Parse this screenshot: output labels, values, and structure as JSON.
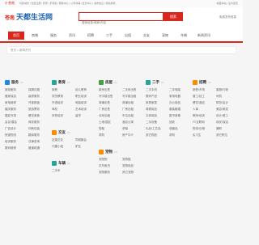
{
  "topbar": {
    "city": "苍南",
    "links": "切换城市 | 免费注册 | 登录 | 手机版 | 帮助中心 | 公司商铺 | 会员中心 | 发布信息 | 网站导航",
    "right": "收藏本站 | 设为首页"
  },
  "header": {
    "city_tag": "苍南",
    "site_name": "天都生活网",
    "search_placeholder": "搜索信息/商家/内容",
    "search_button": "搜索",
    "right_text": "免费发布信息"
  },
  "nav": {
    "items": [
      "首页",
      "商铺",
      "服务",
      "资讯",
      "招聘",
      "二手",
      "出租",
      "交友",
      "宠物",
      "车辆",
      "新闻资讯"
    ]
  },
  "breadcrumb": "首页 > 新闻资讯",
  "categories": [
    {
      "name": "服务",
      "color": "#1e88e5",
      "count": "(0)",
      "items": [
        "家政服务",
        "保姆月嫂",
        "搬家保洁",
        "装修服务",
        "家电维修",
        "开锁换锁",
        "婚庆服务",
        "旅游票务",
        "摄影写真",
        "餐饮美食",
        "会议/展会",
        "商务服务",
        "广告设计",
        "印刷包装",
        "快递物流",
        "翻译服务",
        "培训服务",
        "法律咨询",
        "数码维修",
        "管道疏通"
      ]
    },
    {
      "name": "教育",
      "color": "#26a69a",
      "count": "(0)",
      "items": [
        "家教",
        "幼儿教育",
        "学历教育",
        "职业培训",
        "外语培训",
        "电脑培训",
        "驾校",
        "艺术培训",
        "体育培训",
        "留学"
      ]
    },
    {
      "name": "交友",
      "color": "#fb8c00",
      "count": "(0)",
      "items": [
        "征婚交友",
        "同城聚会",
        "兴趣小组",
        "驴友"
      ]
    },
    {
      "name": "车辆",
      "color": "#26a69a",
      "count": "(0)",
      "items": [
        "二手车"
      ]
    },
    {
      "name": "房屋",
      "color": "#43a047",
      "count": "(0)",
      "items": [
        "新房出售",
        "二手房出售",
        "写字楼出售",
        "写字楼出租",
        "商铺出售",
        "商铺出租",
        "厂房出售",
        "厂房出租",
        "仓库出租",
        "车位出租",
        "土地/园区",
        "酒店公寓",
        "短租",
        "求租",
        "求购",
        "房产中介"
      ]
    },
    {
      "name": "宠物",
      "color": "#fb8c00",
      "count": "(0)",
      "items": [
        "宠物狗",
        "宠物猫",
        "花鸟鱼虫",
        "宠物用品",
        "宠物服务",
        "其它宠物"
      ]
    },
    {
      "name": "二手",
      "color": "#26a69a",
      "count": "(0)",
      "items": [
        "二手手机",
        "二手电脑",
        "数码产品",
        "家用电器",
        "家具家居",
        "办公用品",
        "母婴用品",
        "服装鞋帽",
        "文体用品",
        "图书音像",
        "二手设备",
        "回收",
        "礼品/工艺品",
        "收藏品",
        "其它物品",
        "求购"
      ]
    },
    {
      "name": "招聘",
      "color": "#fb8c00",
      "count": "(0)",
      "items": [
        "销售/市场",
        "客服/行政",
        "普工/技工",
        "司机",
        "餐饮/酒店",
        "财务/会计",
        "人事",
        "美容/美发",
        "教师/培训",
        "设计/美工",
        "IT/互联网",
        "保安/保洁",
        "物流/仓储",
        "兼职",
        "实习生",
        "其它职位"
      ]
    }
  ]
}
